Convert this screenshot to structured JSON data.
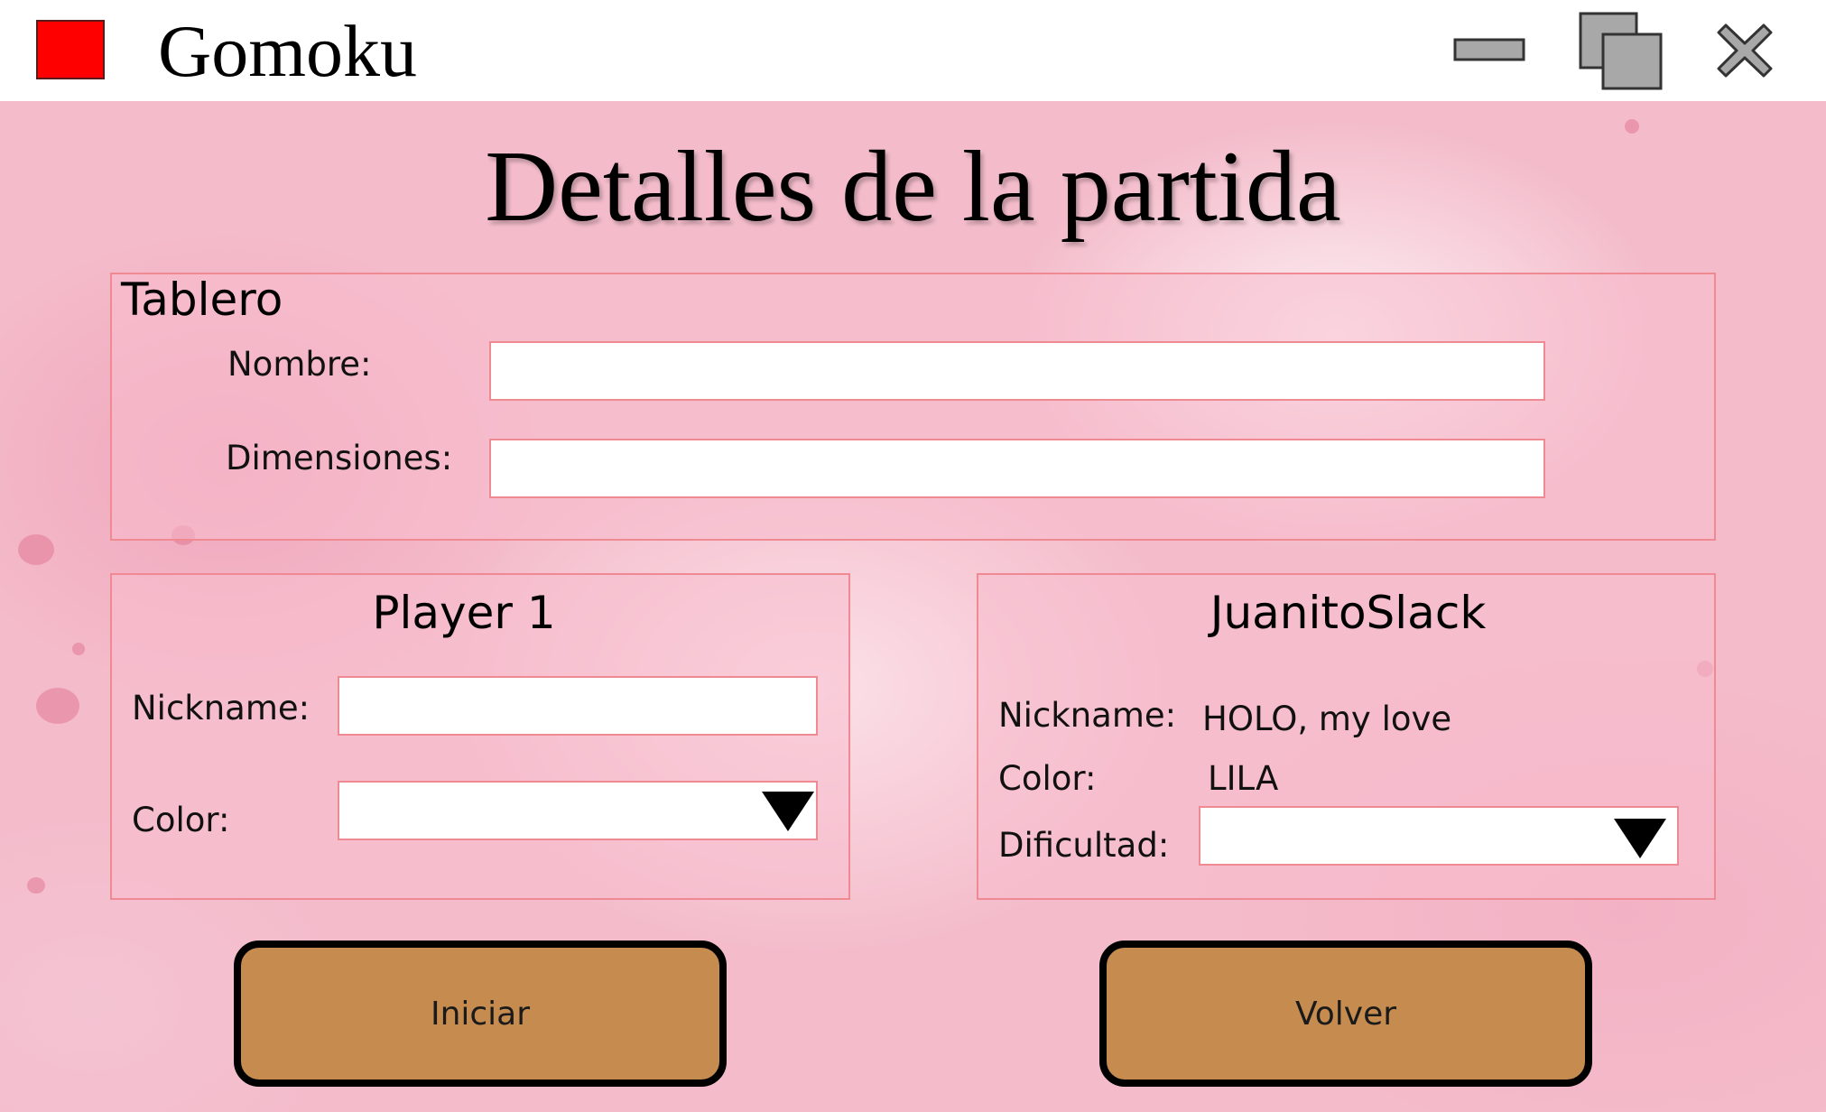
{
  "window": {
    "title": "Gomoku",
    "accent_color": "#ff0000",
    "controls": [
      "minimize-icon",
      "maximize-icon",
      "close-icon"
    ]
  },
  "page": {
    "title": "Detalles de la partida"
  },
  "board": {
    "heading": "Tablero",
    "name_label": "Nombre:",
    "name_value": "",
    "dimensions_label": "Dimensiones:",
    "dimensions_value": ""
  },
  "player1": {
    "heading": "Player 1",
    "nickname_label": "Nickname:",
    "nickname_value": "",
    "color_label": "Color:",
    "color_value": ""
  },
  "player2": {
    "heading": "JuanitoSlack",
    "nickname_label": "Nickname:",
    "nickname_value": "HOLO, my love",
    "color_label": "Color:",
    "color_value": "LILA",
    "difficulty_label": "Dificultad:",
    "difficulty_value": ""
  },
  "actions": {
    "start_label": "Iniciar",
    "back_label": "Volver",
    "button_color": "#c68b4e"
  },
  "colors": {
    "panel_border": "#f08a92",
    "background": "#f4bccb"
  }
}
